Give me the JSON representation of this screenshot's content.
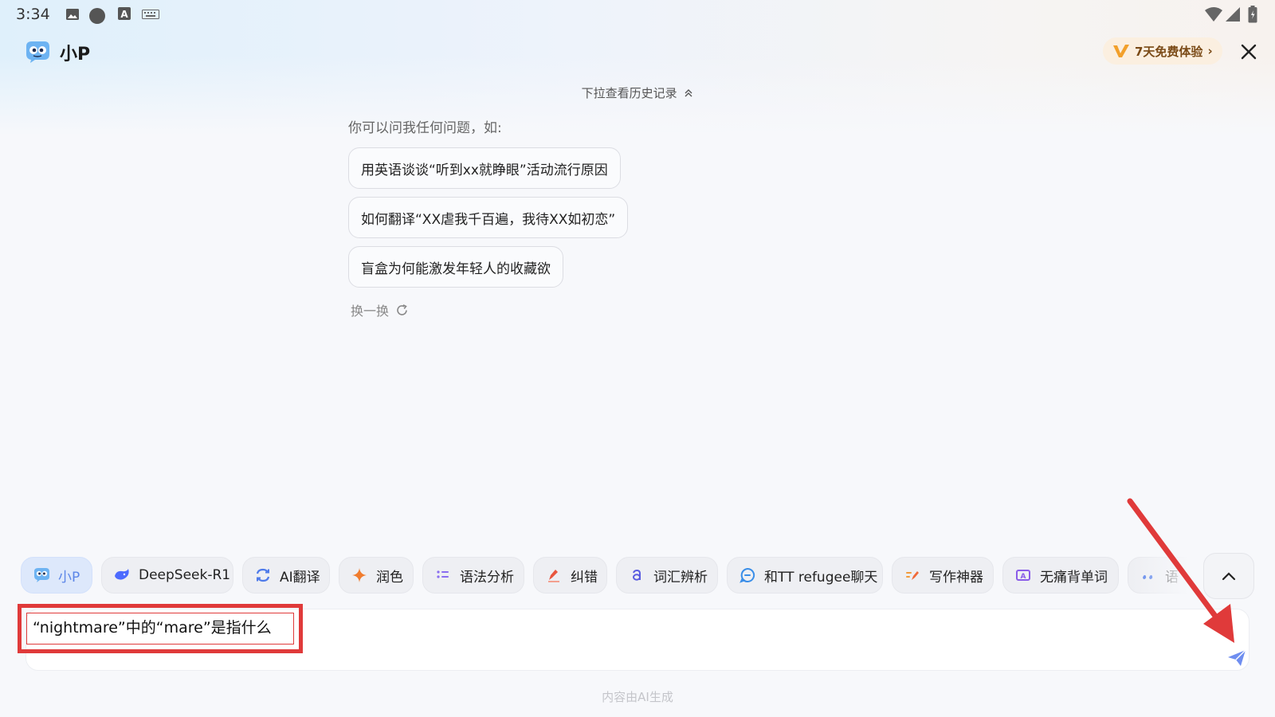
{
  "status_bar": {
    "time": "3:34"
  },
  "header": {
    "title": "小P",
    "trial_label": "7天免费体验"
  },
  "chat": {
    "history_hint": "下拉查看历史记录",
    "intro": "你可以问我任何问题，如:",
    "suggestions": [
      "用英语谈谈“听到xx就睁眼”活动流行原因",
      "如何翻译“XX虐我千百遍，我待XX如初恋”",
      "盲盒为何能激发年轻人的收藏欲"
    ],
    "refresh_label": "换一换"
  },
  "tools": [
    {
      "label": "小P",
      "icon": "xiaop-mascot-icon",
      "active": true
    },
    {
      "label": "DeepSeek-R1",
      "icon": "deepseek-whale-icon",
      "active": false
    },
    {
      "label": "AI翻译",
      "icon": "translate-icon",
      "active": false
    },
    {
      "label": "润色",
      "icon": "sparkle-icon",
      "active": false
    },
    {
      "label": "语法分析",
      "icon": "list-icon",
      "active": false
    },
    {
      "label": "纠错",
      "icon": "pen-icon",
      "active": false
    },
    {
      "label": "词汇辨析",
      "icon": "letter-a-icon",
      "active": false
    },
    {
      "label": "和TT refugee聊天",
      "icon": "chat-bubble-icon",
      "active": false
    },
    {
      "label": "写作神器",
      "icon": "write-icon",
      "active": false
    },
    {
      "label": "无痛背单词",
      "icon": "flashcard-icon",
      "active": false
    },
    {
      "label": "语",
      "icon": "dots-icon",
      "active": false
    }
  ],
  "input": {
    "value": "“nightmare”中的“mare”是指什么"
  },
  "footer": {
    "note": "内容由AI生成"
  },
  "colors": {
    "accent": "#5c86e8",
    "annotation": "#e03a3a",
    "trial_text": "#7a4a16"
  }
}
